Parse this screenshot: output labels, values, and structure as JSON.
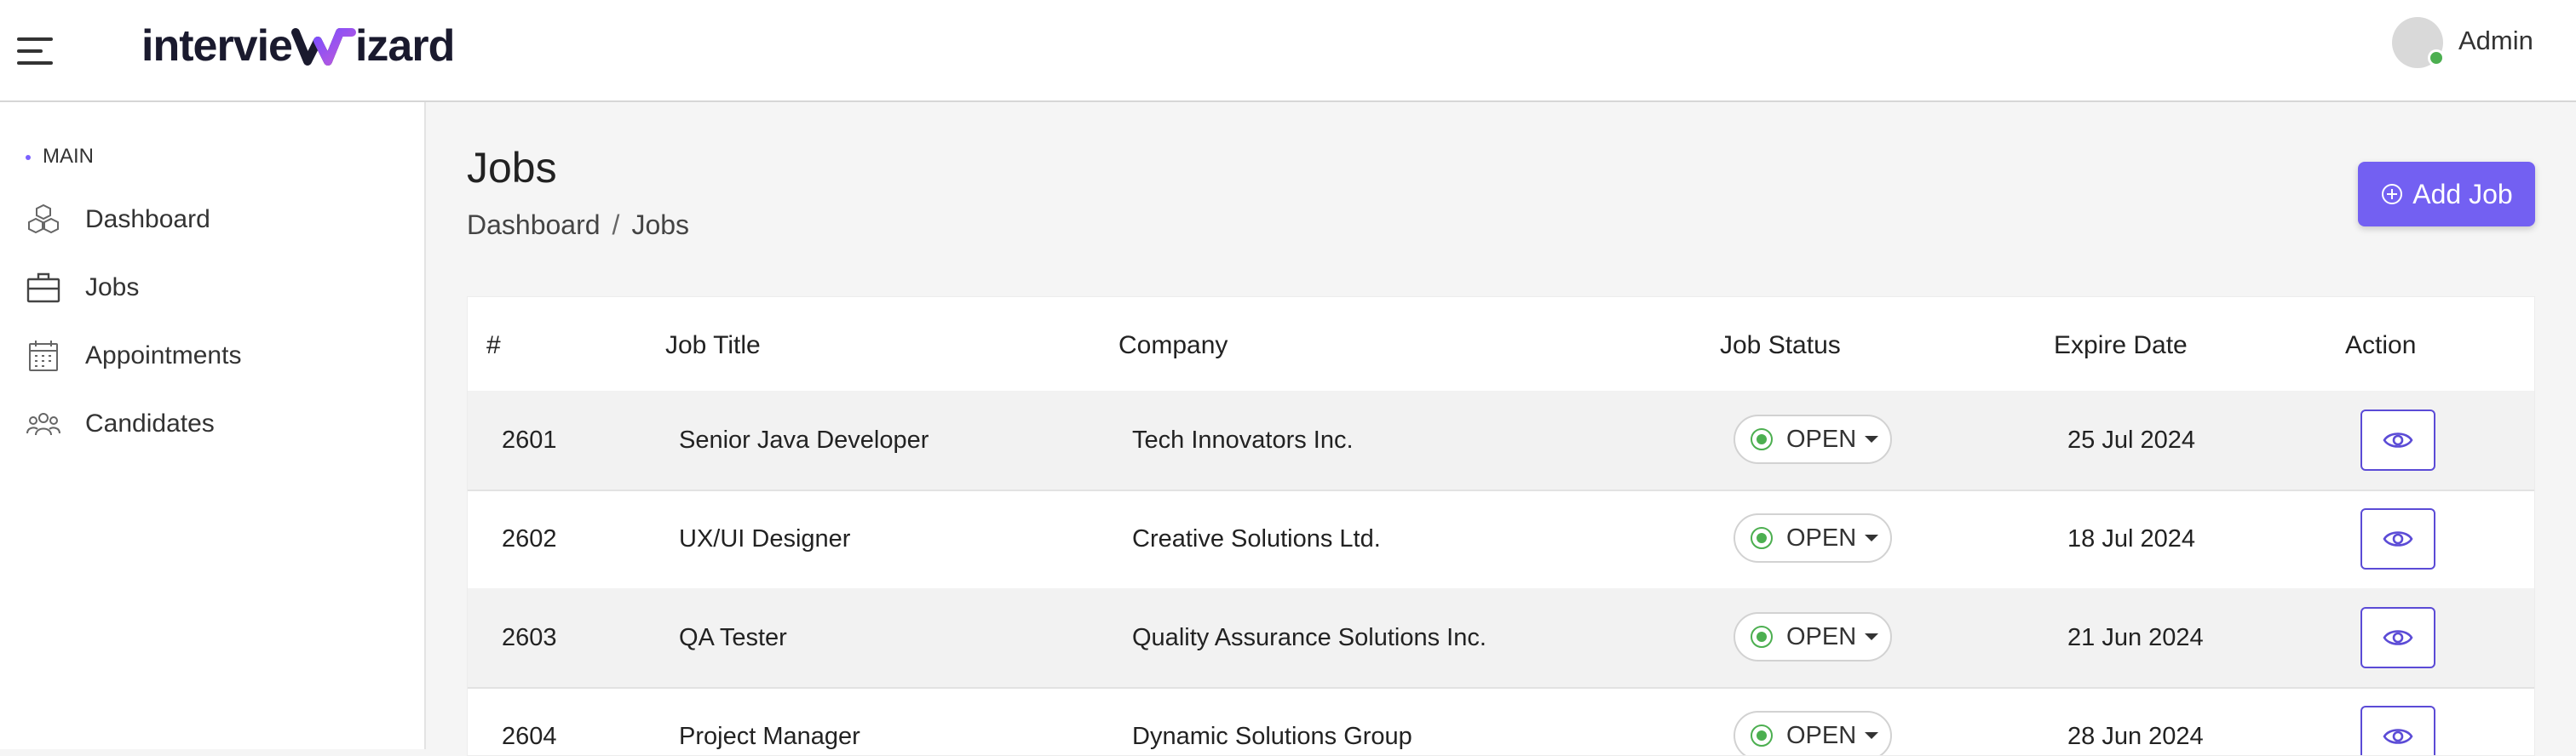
{
  "brand": {
    "logo_text_left": "intervie",
    "logo_text_right": "izard"
  },
  "user": {
    "name": "Admin"
  },
  "sidebar": {
    "section": "MAIN",
    "items": [
      {
        "label": "Dashboard",
        "icon": "cubes-icon"
      },
      {
        "label": "Jobs",
        "icon": "briefcase-icon"
      },
      {
        "label": "Appointments",
        "icon": "calendar-icon"
      },
      {
        "label": "Candidates",
        "icon": "users-icon"
      }
    ]
  },
  "page": {
    "title": "Jobs",
    "breadcrumb": {
      "home": "Dashboard",
      "separator": "/",
      "current": "Jobs"
    },
    "add_button": "Add Job"
  },
  "table": {
    "headers": {
      "id": "#",
      "title": "Job Title",
      "company": "Company",
      "status": "Job Status",
      "expire": "Expire Date",
      "action": "Action"
    },
    "rows": [
      {
        "id": "2601",
        "title": "Senior Java Developer",
        "company": "Tech Innovators Inc.",
        "status": "OPEN",
        "expire": "25 Jul 2024"
      },
      {
        "id": "2602",
        "title": "UX/UI Designer",
        "company": "Creative Solutions Ltd.",
        "status": "OPEN",
        "expire": "18 Jul 2024"
      },
      {
        "id": "2603",
        "title": "QA Tester",
        "company": "Quality Assurance Solutions Inc.",
        "status": "OPEN",
        "expire": "21 Jun 2024"
      },
      {
        "id": "2604",
        "title": "Project Manager",
        "company": "Dynamic Solutions Group",
        "status": "OPEN",
        "expire": "28 Jun 2024"
      }
    ]
  },
  "colors": {
    "accent": "#7360f2",
    "status_open": "#4caf50",
    "online": "#4caf50"
  }
}
